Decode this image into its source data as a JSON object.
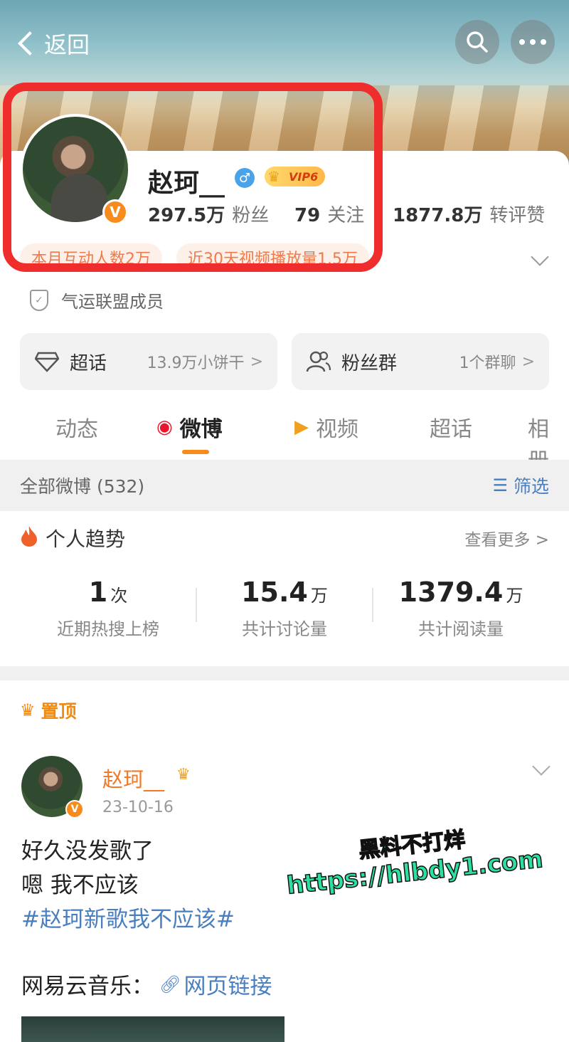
{
  "topbar": {
    "back_label": "返回"
  },
  "profile": {
    "username": "赵珂__",
    "gender_symbol": "♂",
    "vip_label": "VIP6",
    "verified_mark": "V",
    "stats": [
      {
        "value": "297.5万",
        "label": "粉丝"
      },
      {
        "value": "79",
        "label": "关注"
      },
      {
        "value": "1877.8万",
        "label": "转评赞"
      }
    ],
    "pills": [
      "本月互动人数2万",
      "近30天视频播放量1.5万"
    ],
    "member_label": "气运联盟成员"
  },
  "tiles": [
    {
      "name": "超话",
      "extra": "13.9万小饼干",
      "arrow": ">"
    },
    {
      "name": "粉丝群",
      "extra": "1个群聊",
      "arrow": ">"
    }
  ],
  "tabs": [
    "动态",
    "微博",
    "视频",
    "超话",
    "相册"
  ],
  "filterbar": {
    "all_label": "全部微博 (532)",
    "filter_label": "筛选"
  },
  "trend": {
    "title": "个人趋势",
    "more_label": "查看更多 >",
    "stats": [
      {
        "value": "1",
        "unit": "次",
        "caption": "近期热搜上榜"
      },
      {
        "value": "15.4",
        "unit": "万",
        "caption": "共计讨论量"
      },
      {
        "value": "1379.4",
        "unit": "万",
        "caption": "共计阅读量"
      }
    ]
  },
  "post": {
    "pinned_label": "置顶",
    "author": "赵珂__",
    "date": "23-10-16",
    "lines": [
      "好久没发歌了",
      "嗯 我不应该"
    ],
    "hashtag": "#赵珂新歌我不应该#",
    "music_label": "网易云音乐：",
    "link_label": "网页链接"
  },
  "watermark": {
    "line1": "黑料不打烊",
    "line2": "https://hlbdy1.com"
  },
  "colors": {
    "accent": "#f78c1c",
    "link": "#4a7fbf",
    "highlight_box": "#f02d2d"
  }
}
